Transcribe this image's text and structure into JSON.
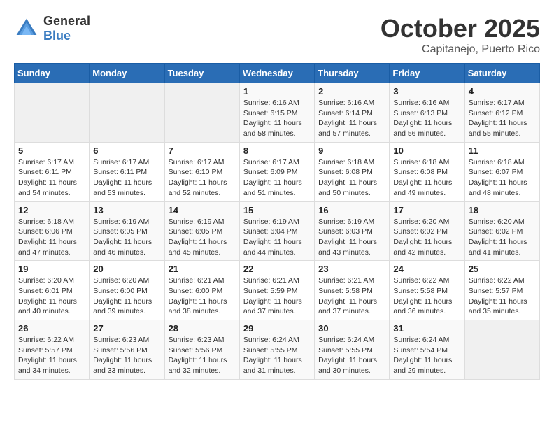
{
  "header": {
    "logo": {
      "text_general": "General",
      "text_blue": "Blue"
    },
    "title": "October 2025",
    "location": "Capitanejo, Puerto Rico"
  },
  "weekdays": [
    "Sunday",
    "Monday",
    "Tuesday",
    "Wednesday",
    "Thursday",
    "Friday",
    "Saturday"
  ],
  "weeks": [
    [
      {
        "day": "",
        "empty": true
      },
      {
        "day": "",
        "empty": true
      },
      {
        "day": "",
        "empty": true
      },
      {
        "day": "1",
        "sunrise": "6:16 AM",
        "sunset": "6:15 PM",
        "daylight": "11 hours and 58 minutes."
      },
      {
        "day": "2",
        "sunrise": "6:16 AM",
        "sunset": "6:14 PM",
        "daylight": "11 hours and 57 minutes."
      },
      {
        "day": "3",
        "sunrise": "6:16 AM",
        "sunset": "6:13 PM",
        "daylight": "11 hours and 56 minutes."
      },
      {
        "day": "4",
        "sunrise": "6:17 AM",
        "sunset": "6:12 PM",
        "daylight": "11 hours and 55 minutes."
      }
    ],
    [
      {
        "day": "5",
        "sunrise": "6:17 AM",
        "sunset": "6:11 PM",
        "daylight": "11 hours and 54 minutes."
      },
      {
        "day": "6",
        "sunrise": "6:17 AM",
        "sunset": "6:11 PM",
        "daylight": "11 hours and 53 minutes."
      },
      {
        "day": "7",
        "sunrise": "6:17 AM",
        "sunset": "6:10 PM",
        "daylight": "11 hours and 52 minutes."
      },
      {
        "day": "8",
        "sunrise": "6:17 AM",
        "sunset": "6:09 PM",
        "daylight": "11 hours and 51 minutes."
      },
      {
        "day": "9",
        "sunrise": "6:18 AM",
        "sunset": "6:08 PM",
        "daylight": "11 hours and 50 minutes."
      },
      {
        "day": "10",
        "sunrise": "6:18 AM",
        "sunset": "6:08 PM",
        "daylight": "11 hours and 49 minutes."
      },
      {
        "day": "11",
        "sunrise": "6:18 AM",
        "sunset": "6:07 PM",
        "daylight": "11 hours and 48 minutes."
      }
    ],
    [
      {
        "day": "12",
        "sunrise": "6:18 AM",
        "sunset": "6:06 PM",
        "daylight": "11 hours and 47 minutes."
      },
      {
        "day": "13",
        "sunrise": "6:19 AM",
        "sunset": "6:05 PM",
        "daylight": "11 hours and 46 minutes."
      },
      {
        "day": "14",
        "sunrise": "6:19 AM",
        "sunset": "6:05 PM",
        "daylight": "11 hours and 45 minutes."
      },
      {
        "day": "15",
        "sunrise": "6:19 AM",
        "sunset": "6:04 PM",
        "daylight": "11 hours and 44 minutes."
      },
      {
        "day": "16",
        "sunrise": "6:19 AM",
        "sunset": "6:03 PM",
        "daylight": "11 hours and 43 minutes."
      },
      {
        "day": "17",
        "sunrise": "6:20 AM",
        "sunset": "6:02 PM",
        "daylight": "11 hours and 42 minutes."
      },
      {
        "day": "18",
        "sunrise": "6:20 AM",
        "sunset": "6:02 PM",
        "daylight": "11 hours and 41 minutes."
      }
    ],
    [
      {
        "day": "19",
        "sunrise": "6:20 AM",
        "sunset": "6:01 PM",
        "daylight": "11 hours and 40 minutes."
      },
      {
        "day": "20",
        "sunrise": "6:20 AM",
        "sunset": "6:00 PM",
        "daylight": "11 hours and 39 minutes."
      },
      {
        "day": "21",
        "sunrise": "6:21 AM",
        "sunset": "6:00 PM",
        "daylight": "11 hours and 38 minutes."
      },
      {
        "day": "22",
        "sunrise": "6:21 AM",
        "sunset": "5:59 PM",
        "daylight": "11 hours and 37 minutes."
      },
      {
        "day": "23",
        "sunrise": "6:21 AM",
        "sunset": "5:58 PM",
        "daylight": "11 hours and 37 minutes."
      },
      {
        "day": "24",
        "sunrise": "6:22 AM",
        "sunset": "5:58 PM",
        "daylight": "11 hours and 36 minutes."
      },
      {
        "day": "25",
        "sunrise": "6:22 AM",
        "sunset": "5:57 PM",
        "daylight": "11 hours and 35 minutes."
      }
    ],
    [
      {
        "day": "26",
        "sunrise": "6:22 AM",
        "sunset": "5:57 PM",
        "daylight": "11 hours and 34 minutes."
      },
      {
        "day": "27",
        "sunrise": "6:23 AM",
        "sunset": "5:56 PM",
        "daylight": "11 hours and 33 minutes."
      },
      {
        "day": "28",
        "sunrise": "6:23 AM",
        "sunset": "5:56 PM",
        "daylight": "11 hours and 32 minutes."
      },
      {
        "day": "29",
        "sunrise": "6:24 AM",
        "sunset": "5:55 PM",
        "daylight": "11 hours and 31 minutes."
      },
      {
        "day": "30",
        "sunrise": "6:24 AM",
        "sunset": "5:55 PM",
        "daylight": "11 hours and 30 minutes."
      },
      {
        "day": "31",
        "sunrise": "6:24 AM",
        "sunset": "5:54 PM",
        "daylight": "11 hours and 29 minutes."
      },
      {
        "day": "",
        "empty": true
      }
    ]
  ],
  "labels": {
    "sunrise_prefix": "Sunrise: ",
    "sunset_prefix": "Sunset: ",
    "daylight_prefix": "Daylight: "
  }
}
